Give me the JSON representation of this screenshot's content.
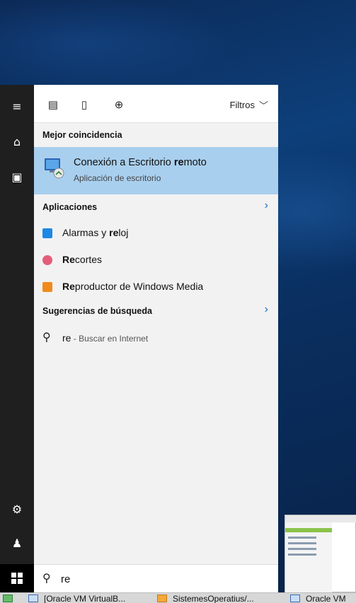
{
  "rail": {
    "menu_icon": "≡",
    "home_icon": "⌂",
    "documents_icon": "▣",
    "settings_icon": "⚙",
    "user_icon": "♟",
    "start_icon": "▦"
  },
  "topbar": {
    "apps_icon": "▤",
    "document_icon": "▯",
    "web_icon": "⊕",
    "filters_label": "Filtros",
    "filters_chevron": "﹀"
  },
  "best_match": {
    "section_label": "Mejor coincidencia",
    "title_pre": "Conexión a Escritorio ",
    "title_bold": "re",
    "title_post": "moto",
    "subtitle": "Aplicación de escritorio"
  },
  "apps": {
    "section_label": "Aplicaciones",
    "arrow": "›",
    "items": [
      {
        "pre": "Alarmas y ",
        "bold": "re",
        "post": "loj",
        "icon_color": "#1e88e5"
      },
      {
        "pre": "",
        "bold": "Re",
        "post": "cortes",
        "icon_color": "#e35d7a"
      },
      {
        "pre": "",
        "bold": "Re",
        "post": "productor de Windows Media",
        "icon_color": "#f08a1c"
      }
    ]
  },
  "suggestions": {
    "section_label": "Sugerencias de búsqueda",
    "arrow": "›",
    "query": "re",
    "hint": " - Buscar en Internet"
  },
  "search": {
    "glyph": "⚲",
    "value": "re"
  },
  "taskbar": {
    "item1": "[Oracle VM VirtualB...",
    "item2": "SistemesOperatius/...",
    "item3": "Oracle VM"
  }
}
